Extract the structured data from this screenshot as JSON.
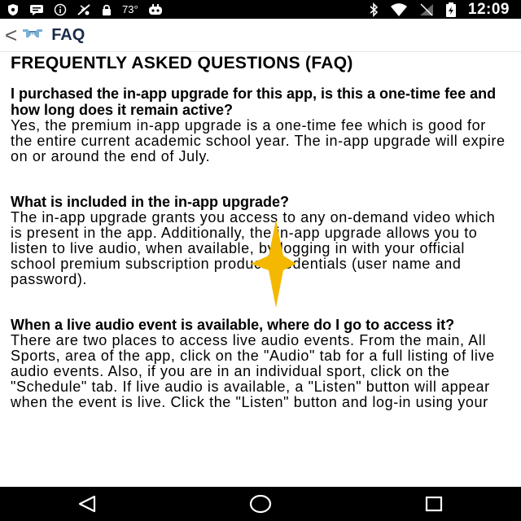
{
  "status_bar": {
    "temperature": "73°",
    "time": "12:09"
  },
  "header": {
    "title": "FAQ",
    "back_icon": "chevron-left-icon",
    "logo_icon": "team-logo-icon"
  },
  "page": {
    "heading": "FREQUENTLY ASKED QUESTIONS (FAQ)"
  },
  "faqs": [
    {
      "question": "I purchased the in-app upgrade for this app, is this a one-time fee and how long does it remain active?",
      "answer": "Yes, the premium in-app upgrade is a one-time fee which is good for the entire current academic school year. The in-app upgrade will expire on or around the end of July."
    },
    {
      "question": "What is included in the in-app upgrade?",
      "answer": "The in-app upgrade grants you access to any on-demand video which is present in the app. Additionally, the in-app upgrade allows you to listen to live audio, when available, by logging in with your official school premium subscription product credentials (user name and password)."
    },
    {
      "question": "When a live audio event is available, where do I go to access it?",
      "answer": "There are two places to access live audio events. From the main, All Sports, area of the app, click on the \"Audio\" tab for a full listing of live audio events. Also, if you are in an individual sport, click on the \"Schedule\" tab. If live audio is available, a \"Listen\" button will appear when the event is live. Click the \"Listen\" button and log-in using your"
    }
  ],
  "colors": {
    "accent": "#f5b800",
    "title": "#1b2a4a",
    "logo": "#7bafd4"
  }
}
